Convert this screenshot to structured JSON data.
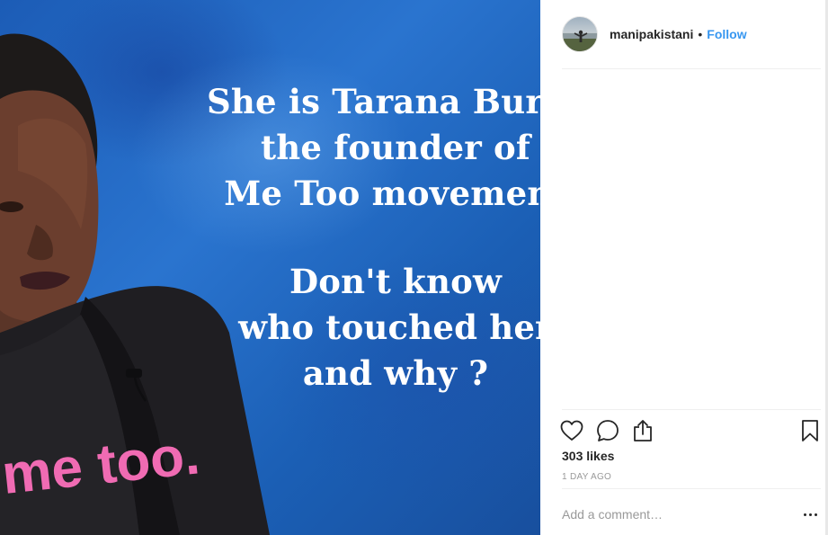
{
  "post": {
    "image_lines": [
      "She is Tarana Burke",
      "the founder of",
      "Me Too movement",
      "Don't know",
      "who touched her",
      "and why ?"
    ],
    "shirt_text": "me too."
  },
  "header": {
    "username": "manipakistani",
    "separator": "•",
    "follow_label": "Follow"
  },
  "icons": {
    "like": "heart-icon",
    "comment": "comment-bubble-icon",
    "share": "share-icon",
    "save": "bookmark-icon",
    "more": "more-options-icon"
  },
  "stats": {
    "likes": "303 likes",
    "timestamp": "1 DAY AGO"
  },
  "comment": {
    "placeholder": "Add a comment…"
  },
  "colors": {
    "accent": "#3897f0",
    "background_blue": "#2a74cf",
    "text": "#262626",
    "muted": "#999999",
    "shirt_pink": "#f06bb3"
  }
}
